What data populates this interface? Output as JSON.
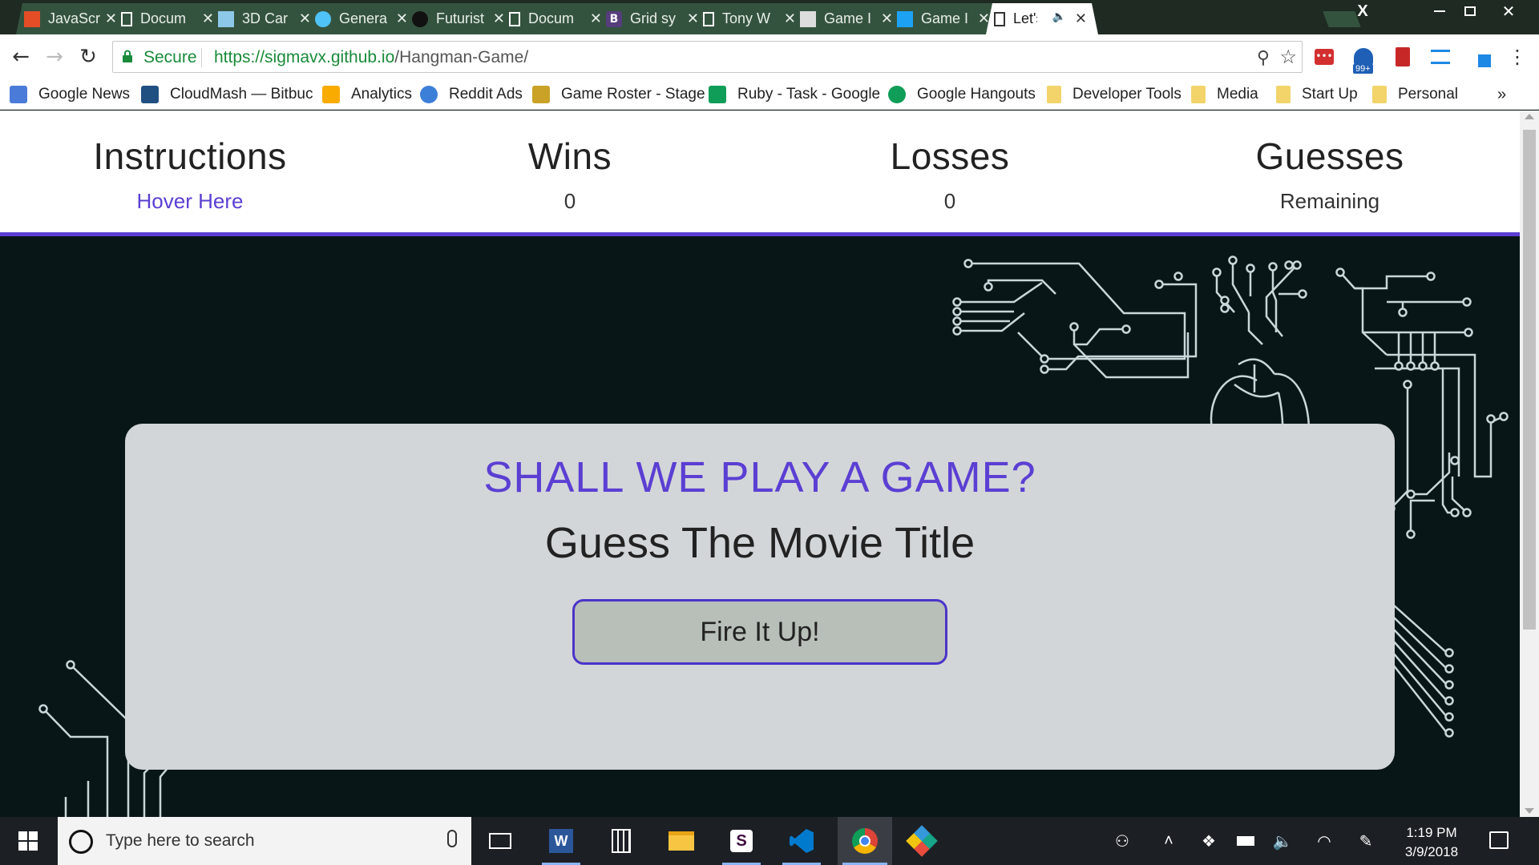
{
  "browser": {
    "tabs": [
      {
        "label": "JavaScr",
        "icon": "javascript-icon",
        "color": "#e44d26"
      },
      {
        "label": "Docum",
        "icon": "document-icon",
        "color": "#ffffff"
      },
      {
        "label": "3D Car",
        "icon": "image-icon",
        "color": "#8ec8e8"
      },
      {
        "label": "Genera",
        "icon": "chrome-ext-icon",
        "color": "#4fc3f7"
      },
      {
        "label": "Futurist",
        "icon": "camera-icon",
        "color": "#111111"
      },
      {
        "label": "Docum",
        "icon": "document-icon",
        "color": "#ffffff"
      },
      {
        "label": "Grid sy",
        "icon": "bootstrap-icon",
        "color": "#563d7c"
      },
      {
        "label": "Tony W",
        "icon": "document-icon",
        "color": "#ffffff"
      },
      {
        "label": "Game I",
        "icon": "apple-icon",
        "color": "#dddddd"
      },
      {
        "label": "Game I",
        "icon": "twitter-icon",
        "color": "#1da1f2"
      },
      {
        "label": "Let's",
        "icon": "document-icon",
        "color": "#333333",
        "active": true,
        "audio": true
      }
    ],
    "window_controls": {
      "extra": "X",
      "minimize": "—",
      "restore": "❐",
      "close": "✕"
    },
    "security_label": "Secure",
    "url_base": "https://sigmavx.github.io",
    "url_path": "/Hangman-Game/",
    "extension_badge": "99+"
  },
  "bookmarks": [
    {
      "label": "Google News",
      "icon": "google-news-icon",
      "color": "#4a7bd8"
    },
    {
      "label": "CloudMash — Bitbuc",
      "icon": "bitbucket-icon",
      "color": "#205081"
    },
    {
      "label": "Analytics",
      "icon": "analytics-icon",
      "color": "#f9ab00"
    },
    {
      "label": "Reddit Ads",
      "icon": "reddit-icon",
      "color": "#3c7fd8"
    },
    {
      "label": "Game Roster - Stage",
      "icon": "game-roster-icon",
      "color": "#c9a227"
    },
    {
      "label": "Ruby - Task - Google",
      "icon": "sheets-icon",
      "color": "#0f9d58"
    },
    {
      "label": "Google Hangouts",
      "icon": "hangouts-icon",
      "color": "#0f9d58"
    },
    {
      "label": "Developer Tools",
      "icon": "folder-icon",
      "color": "#f2d46b"
    },
    {
      "label": "Media",
      "icon": "folder-icon",
      "color": "#f2d46b"
    },
    {
      "label": "Start Up",
      "icon": "folder-icon",
      "color": "#f2d46b"
    },
    {
      "label": "Personal",
      "icon": "folder-icon",
      "color": "#f2d46b"
    }
  ],
  "bookmarks_overflow": "»",
  "scoreboard": {
    "instructions": {
      "heading": "Instructions",
      "value": "Hover Here"
    },
    "wins": {
      "heading": "Wins",
      "value": "0"
    },
    "losses": {
      "heading": "Losses",
      "value": "0"
    },
    "guesses": {
      "heading": "Guesses",
      "value": "Remaining"
    }
  },
  "game": {
    "tagline": "SHALL WE PLAY A GAME?",
    "subtitle": "Guess The Movie Title",
    "start_button": "Fire It Up!"
  },
  "taskbar": {
    "search_placeholder": "Type here to search",
    "apps": [
      "task-view-icon",
      "word-icon",
      "calculator-icon",
      "file-explorer-icon",
      "slack-icon",
      "vscode-icon",
      "chrome-icon",
      "git-kraken-icon"
    ],
    "time": "1:19 PM",
    "date": "3/9/2018"
  },
  "colors": {
    "accent": "#5b3fd3",
    "circuit": "#7fe0f0",
    "stage_bg": "#091617",
    "card_bg": "#d3d6d9"
  }
}
